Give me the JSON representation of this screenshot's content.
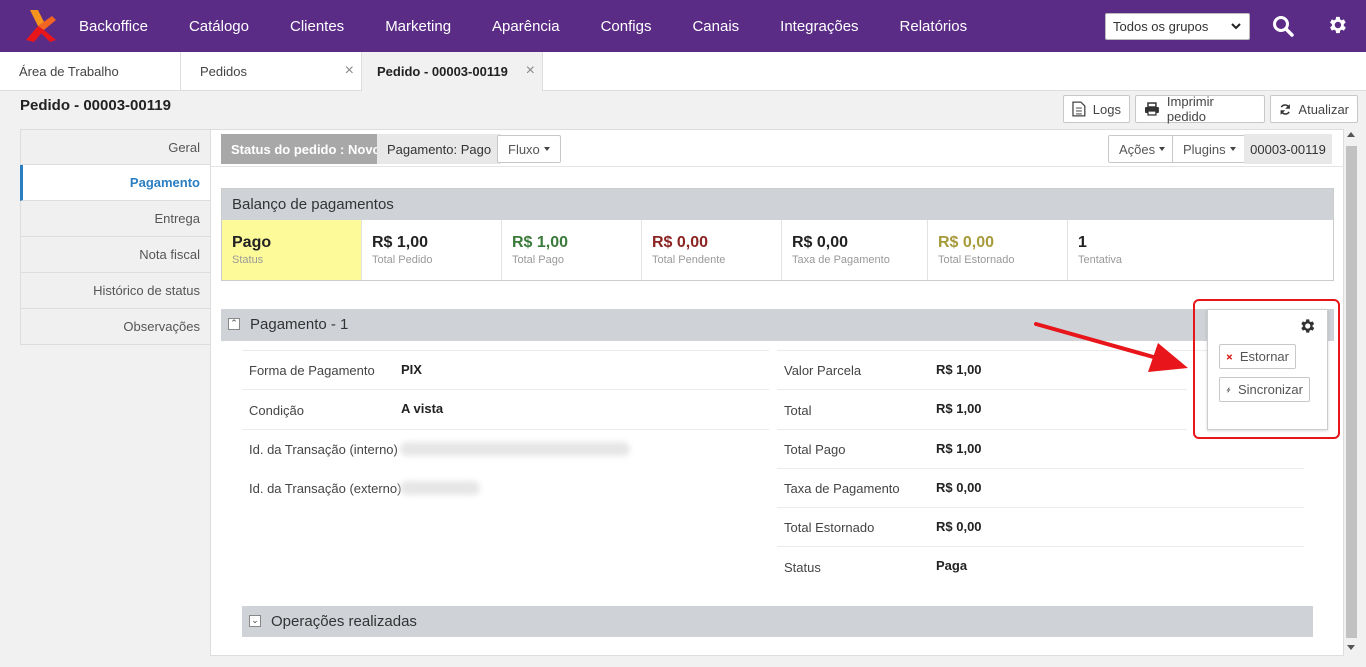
{
  "topnav": {
    "items": [
      "Backoffice",
      "Catálogo",
      "Clientes",
      "Marketing",
      "Aparência",
      "Configs",
      "Canais",
      "Integrações",
      "Relatórios"
    ],
    "group_select": "Todos os grupos"
  },
  "tabs": [
    {
      "label": "Área de Trabalho"
    },
    {
      "label": "Pedidos",
      "close": "×"
    },
    {
      "label": "Pedido - 00003-00119",
      "close": "×"
    }
  ],
  "page": {
    "title": "Pedido - 00003-00119",
    "buttons": {
      "logs": "Logs",
      "print": "Imprimir pedido",
      "refresh": "Atualizar"
    }
  },
  "leftmenu": [
    "Geral",
    "Pagamento",
    "Entrega",
    "Nota fiscal",
    "Histórico de status",
    "Observações"
  ],
  "statusbar": {
    "order_status": "Status do pedido : Novo",
    "payment_status": "Pagamento: Pago",
    "flow": "Fluxo",
    "actions": "Ações",
    "plugins": "Plugins",
    "order_code": "00003-00119"
  },
  "balance": {
    "title": "Balanço de pagamentos",
    "cells": [
      {
        "value": "Pago",
        "label": "Status",
        "color": "#222222"
      },
      {
        "value": "R$ 1,00",
        "label": "Total Pedido",
        "color": "#222222"
      },
      {
        "value": "R$ 1,00",
        "label": "Total Pago",
        "color": "#3a7a3a"
      },
      {
        "value": "R$ 0,00",
        "label": "Total Pendente",
        "color": "#8b2323"
      },
      {
        "value": "R$ 0,00",
        "label": "Taxa de Pagamento",
        "color": "#222222"
      },
      {
        "value": "R$ 0,00",
        "label": "Total Estornado",
        "color": "#a69a3a"
      },
      {
        "value": "1",
        "label": "Tentativa",
        "color": "#222222"
      }
    ],
    "status_bg": "#fdfa9a"
  },
  "payment": {
    "title": "Pagamento - 1",
    "left": [
      {
        "label": "Forma de Pagamento",
        "value": "PIX"
      },
      {
        "label": "Condição",
        "value": "A vista"
      },
      {
        "label": "Id. da Transação (interno)",
        "value": ""
      },
      {
        "label": "Id. da Transação (externo)",
        "value": ""
      }
    ],
    "right": [
      {
        "label": "Valor Parcela",
        "value": "R$ 1,00"
      },
      {
        "label": "Total",
        "value": "R$ 1,00"
      },
      {
        "label": "Total Pago",
        "value": "R$ 1,00"
      },
      {
        "label": "Taxa de Pagamento",
        "value": "R$ 0,00"
      },
      {
        "label": "Total Estornado",
        "value": "R$ 0,00"
      },
      {
        "label": "Status",
        "value": "Paga"
      }
    ],
    "popover": {
      "refund": "Estornar",
      "sync": "Sincronizar"
    }
  },
  "operations": {
    "title": "Operações realizadas"
  }
}
